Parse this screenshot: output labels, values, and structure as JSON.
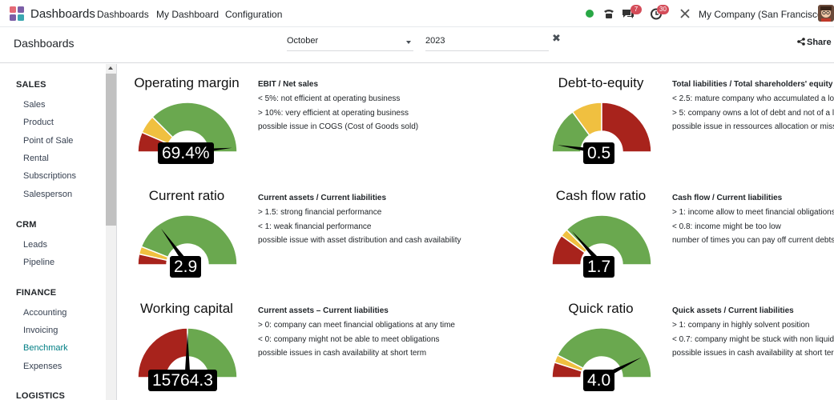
{
  "navbar": {
    "app_name": "Dashboards",
    "menu": [
      "Dashboards",
      "My Dashboard",
      "Configuration"
    ],
    "messages_count": "7",
    "activities_count": "30",
    "company": "My Company (San Francisco)"
  },
  "control": {
    "breadcrumb": "Dashboards",
    "month": "October",
    "year": "2023",
    "share_label": "Share"
  },
  "sidebar": {
    "sections": [
      {
        "title": "SALES",
        "items": [
          "Sales",
          "Product",
          "Point of Sale",
          "Rental",
          "Subscriptions",
          "Salesperson"
        ]
      },
      {
        "title": "CRM",
        "items": [
          "Leads",
          "Pipeline"
        ]
      },
      {
        "title": "FINANCE",
        "items": [
          "Accounting",
          "Invoicing",
          "Benchmark",
          "Expenses"
        ]
      },
      {
        "title": "LOGISTICS",
        "items": []
      }
    ],
    "active_item": "Benchmark"
  },
  "colors": {
    "red": "#a8231c",
    "yellow": "#f0c040",
    "green": "#6aa84f",
    "accent": "#017e84"
  },
  "kpis": [
    {
      "title": "Operating margin",
      "value": "69.4%",
      "formula": "EBIT / Net sales",
      "lines": [
        "< 5%: not efficient at operating business",
        "> 10%: very efficient at operating business",
        "possible issue in COGS (Cost of Goods sold)"
      ],
      "bands": [
        {
          "color": "red",
          "from": 0,
          "to": 0.13
        },
        {
          "color": "yellow",
          "from": 0.13,
          "to": 0.25
        },
        {
          "color": "green",
          "from": 0.25,
          "to": 1
        }
      ],
      "needle": 0.97
    },
    {
      "title": "Debt-to-equity",
      "value": "0.5",
      "formula": "Total liabilities / Total shareholders' equity",
      "lines": [
        "< 2.5: mature company who accumulated a lo",
        "> 5: company owns a lot of debt and not of a l",
        "possible issue in ressources allocation or miss"
      ],
      "bands": [
        {
          "color": "green",
          "from": 0,
          "to": 0.3
        },
        {
          "color": "yellow",
          "from": 0.3,
          "to": 0.5
        },
        {
          "color": "red",
          "from": 0.5,
          "to": 1
        }
      ],
      "needle": 0.05
    },
    {
      "title": "Current ratio",
      "value": "2.9",
      "formula": "Current assets / Current liabilities",
      "lines": [
        "> 1.5: strong financial performance",
        "< 1: weak financial performance",
        "possible issue with asset distribution and cash availability"
      ],
      "bands": [
        {
          "color": "red",
          "from": 0,
          "to": 0.07
        },
        {
          "color": "yellow",
          "from": 0.07,
          "to": 0.12
        },
        {
          "color": "green",
          "from": 0.12,
          "to": 1
        }
      ],
      "needle": 0.3
    },
    {
      "title": "Cash flow ratio",
      "value": "1.7",
      "formula": "Cash flow / Current liabilities",
      "lines": [
        "> 1: income allow to meet financial obligations",
        "< 0.8: income might be too low",
        "number of times you can pay off current debts"
      ],
      "bands": [
        {
          "color": "red",
          "from": 0,
          "to": 0.2
        },
        {
          "color": "yellow",
          "from": 0.2,
          "to": 0.25
        },
        {
          "color": "green",
          "from": 0.25,
          "to": 1
        }
      ],
      "needle": 0.27
    },
    {
      "title": "Working capital",
      "value": "15764.3",
      "formula": "Current assets – Current liabilities",
      "lines": [
        "> 0: company can meet financial obligations at any time",
        "< 0: company might not be able to meet obligations",
        "possible issues in cash availability at short term"
      ],
      "bands": [
        {
          "color": "red",
          "from": 0,
          "to": 0.5
        },
        {
          "color": "green",
          "from": 0.5,
          "to": 1
        }
      ],
      "needle": 0.5
    },
    {
      "title": "Quick ratio",
      "value": "4.0",
      "formula": "Quick assets / Current liabilities",
      "lines": [
        "> 1: company in highly solvent position",
        "< 0.7: company might be stuck with non liquid",
        "possible issues in cash availability at short ter"
      ],
      "bands": [
        {
          "color": "red",
          "from": 0,
          "to": 0.1
        },
        {
          "color": "yellow",
          "from": 0.1,
          "to": 0.15
        },
        {
          "color": "green",
          "from": 0.15,
          "to": 1
        }
      ],
      "needle": 0.85
    }
  ]
}
